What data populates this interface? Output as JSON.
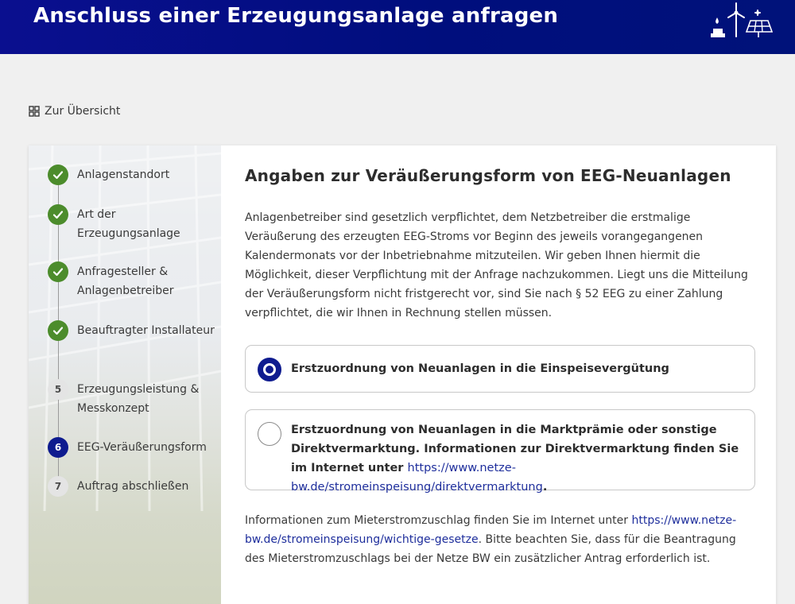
{
  "header": {
    "title": "Anschluss einer Erzeugungsanlage anfragen",
    "icon": "renewable-energy-icon"
  },
  "nav": {
    "back_label": "Zur Übersicht",
    "back_icon": "grid-icon"
  },
  "steps": [
    {
      "number": "1",
      "label": "Anlagenstandort",
      "status": "done"
    },
    {
      "number": "2",
      "label": "Art der Erzeugungsanlage",
      "status": "done"
    },
    {
      "number": "3",
      "label": "Anfragesteller & Anlagenbetreiber",
      "status": "done"
    },
    {
      "number": "4",
      "label": "Beauftragter Installateur",
      "status": "done"
    },
    {
      "number": "5",
      "label": "Erzeugungsleistung & Messkonzept",
      "status": "todo"
    },
    {
      "number": "6",
      "label": "EEG-Veräußerungsform",
      "status": "current"
    },
    {
      "number": "7",
      "label": "Auftrag abschließen",
      "status": "todo"
    }
  ],
  "section": {
    "title": "Angaben zur Veräußerungsform von EEG-Neuanlagen",
    "intro": "Anlagenbetreiber sind gesetzlich verpflichtet, dem Netzbetreiber die erstmalige Veräußerung des erzeugten EEG-Stroms vor Beginn des jeweils vorangegangenen Kalendermonats vor der Inbetriebnahme mitzuteilen. Wir geben Ihnen hiermit die Möglichkeit, dieser Verpflichtung mit der Anfrage nachzukommen. Liegt uns die Mitteilung der Veräußerungsform nicht fristgerecht vor, sind Sie nach § 52 EEG zu einer Zahlung verpflichtet, die wir Ihnen in Rechnung stellen müssen."
  },
  "options": {
    "option1": {
      "label": "Erstzuordnung von Neuanlagen in die Einspeisevergütung",
      "selected": true
    },
    "option2": {
      "label": "Erstzuordnung von Neuanlagen in die Marktprämie oder sonstige Direktvermarktung. Informationen zur Direktvermarktung finden Sie im Internet unter",
      "link": "https://www.netze-bw.de/stromeinspeisung/direktvermarktung",
      "suffix": ".",
      "selected": false
    }
  },
  "info": {
    "prefix": "Informationen zum Mieterstromzuschlag finden Sie im Internet unter",
    "link": "https://www.netze-bw.de/stromeinspeisung/wichtige-gesetze",
    "suffix": ". Bitte beachten Sie, dass für die Beantragung des Mieterstromzuschlags bei der Netze BW ein zusätzlicher Antrag erforderlich ist."
  },
  "colors": {
    "header": "#000e7d",
    "accent": "#0e1b8f",
    "done": "#4c8c2c",
    "link": "#1e2e9c"
  }
}
